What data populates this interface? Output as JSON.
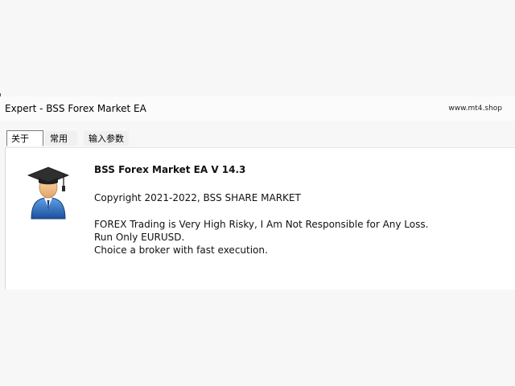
{
  "window": {
    "title": "Expert - BSS Forex Market EA",
    "watermark": "www.mt4.shop"
  },
  "tabs": [
    {
      "label": "关于",
      "active": true
    },
    {
      "label": "常用",
      "active": false
    },
    {
      "label": "输入参数",
      "active": false
    }
  ],
  "about": {
    "icon": "graduate-user-icon",
    "ea_name": "BSS Forex Market EA V 14.3",
    "copyright": "Copyright 2021-2022, BSS SHARE MARKET",
    "description_lines": [
      "FOREX Trading is Very High Risky, I Am Not Responsible for Any Loss.",
      "Run Only EURUSD.",
      "Choice a broker with fast execution."
    ]
  },
  "colors": {
    "background": "#f7f7f7",
    "panel": "#ffffff",
    "cap": "#2f2f2f",
    "face": "#f3c48f",
    "body": "#2d6cc0"
  }
}
